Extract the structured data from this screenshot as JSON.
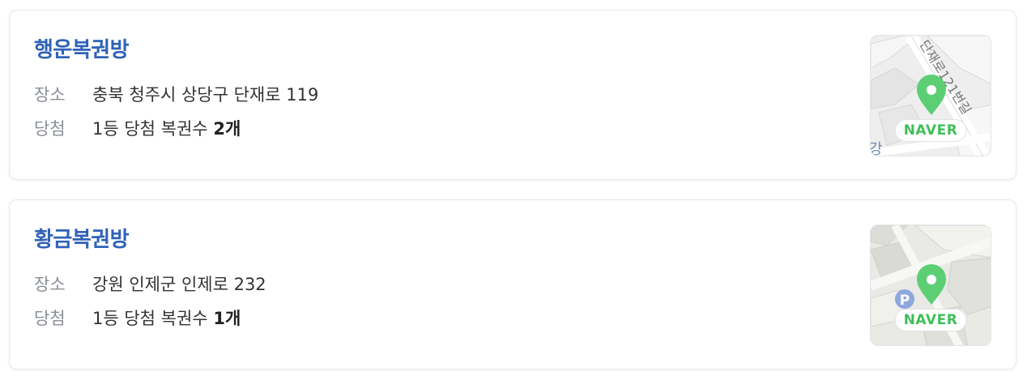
{
  "shops": [
    {
      "name": "행운복권방",
      "location_label": "장소",
      "address": "충북 청주시 상당구 단재로 119",
      "win_label": "당첨",
      "win_prefix": "1등 당첨 복권수",
      "win_count": "2개",
      "map": {
        "brand": "NAVER",
        "road_text": "단재로121번길",
        "corner_text": "강"
      }
    },
    {
      "name": "황금복권방",
      "location_label": "장소",
      "address": "강원 인제군 인제로 232",
      "win_label": "당첨",
      "win_prefix": "1등 당첨 복권수",
      "win_count": "1개",
      "map": {
        "brand": "NAVER",
        "parking_icon": "P"
      }
    }
  ],
  "colors": {
    "title": "#2f62b8",
    "label": "#8a8f96",
    "marker": "#5ccf74"
  }
}
